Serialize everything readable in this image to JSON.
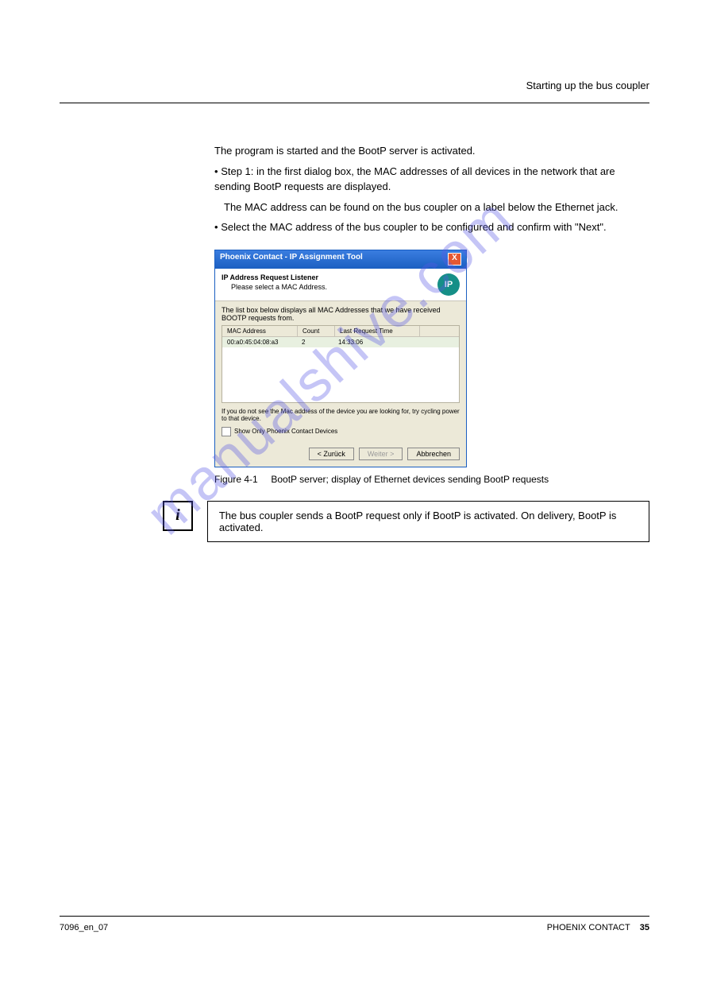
{
  "header": {
    "title": "Starting up the bus coupler"
  },
  "content": {
    "intro": "The program is started and the BootP server is activated.",
    "step1_a": "Step 1: in the first dialog box, the MAC addresses of all devices in the network that are sending BootP requests are displayed.",
    "step1_b": "The MAC address can be found on the bus coupler on a label below the Ethernet jack.",
    "step1_c": "Select the MAC address of the bus coupler to be configured and confirm with \"Next\".",
    "list_bullet": "•"
  },
  "figure": {
    "caption_prefix": "Figure 4-1",
    "caption": "BootP server; display of Ethernet devices sending BootP requests"
  },
  "dialog": {
    "title": "Phoenix Contact - IP Assignment Tool",
    "head1": "IP Address Request Listener",
    "head2": "Please select a MAC Address.",
    "ip_badge": "IP",
    "list_intro": "The list box below displays all MAC Addresses that we have received BOOTP requests from.",
    "cols": {
      "mac": "MAC Address",
      "count": "Count",
      "time": "Last Request Time"
    },
    "row": {
      "mac": "00:a0:45:04:08:a3",
      "count": "2",
      "time": "14:33:06"
    },
    "hint": "If you do not see the Mac address of the device you are looking for, try cycling power to that device.",
    "checkbox": "Show Only Phoenix Contact Devices",
    "back": "< Zurück",
    "next": "Weiter >",
    "cancel": "Abbrechen"
  },
  "note": {
    "text": "The bus coupler sends a BootP request only if BootP is activated. On delivery, BootP is activated."
  },
  "footer": {
    "doc_id": "7096_en_07",
    "right": "PHOENIX CONTACT",
    "page": "35"
  },
  "watermark": "manualshive.com"
}
